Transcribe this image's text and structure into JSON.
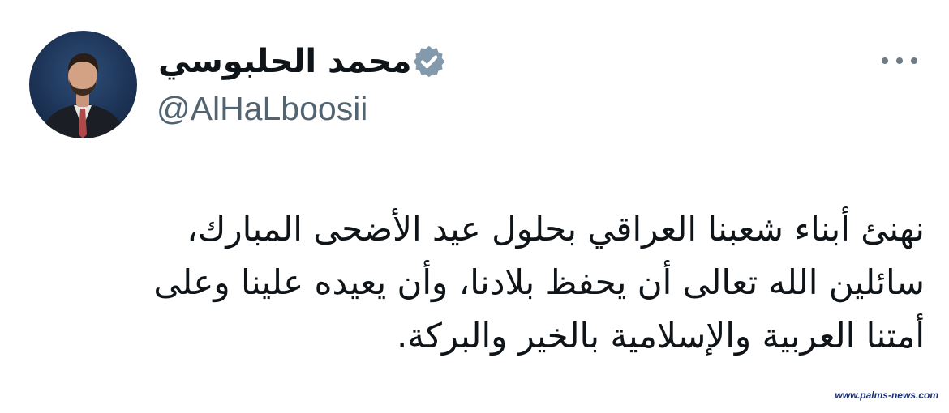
{
  "tweet": {
    "author": {
      "display_name": "محمد الحلبوسي",
      "handle": "@AlHaLboosii",
      "verified": true,
      "verified_color": "#829aab",
      "avatar_icon": "profile-photo"
    },
    "more_icon": "more-horizontal-icon",
    "text_lines": [
      "نهنئ أبناء شعبنا العراقي بحلول عيد الأضحى المبارك،",
      "سائلين الله تعالى أن يحفظ بلادنا، وأن يعيده علينا وعلى",
      "أمتنا العربية والإسلامية بالخير والبركة."
    ]
  },
  "watermark": "www.palms-news.com",
  "colors": {
    "text": "#0f1419",
    "handle": "#536471",
    "icon_gray": "#6e7b85"
  }
}
